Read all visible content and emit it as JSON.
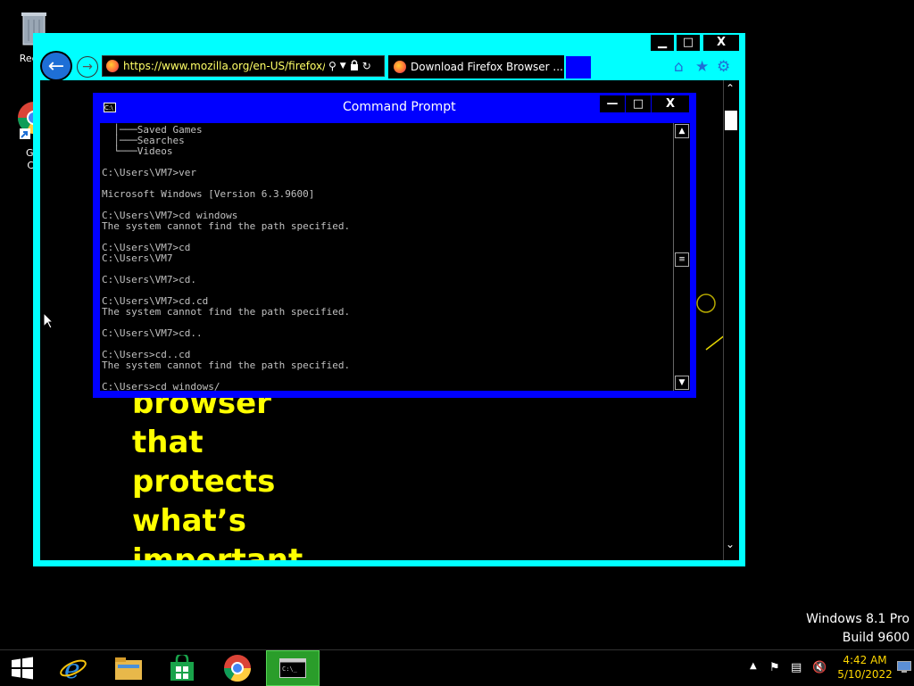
{
  "desktop": {
    "icons": [
      {
        "label": "Recyc"
      },
      {
        "label_line1": "Goo",
        "label_line2": "Chr"
      }
    ]
  },
  "browser": {
    "url": "https://www.mozilla.org/en-US/firefox/ne",
    "tab_title": "Download Firefox Browser ...",
    "controls": {
      "minimize": "▁",
      "maximize": "□",
      "close": "X"
    }
  },
  "page": {
    "headline_lines": [
      "browser",
      "that",
      "protects",
      "what’s",
      "important"
    ]
  },
  "cmd": {
    "title": "Command Prompt",
    "controls": {
      "minimize": "—",
      "maximize": "□",
      "close": "X"
    },
    "lines": [
      "  │───Saved Games",
      "  │───Searches",
      "  └───Videos",
      "",
      "C:\\Users\\VM7>ver",
      "",
      "Microsoft Windows [Version 6.3.9600]",
      "",
      "C:\\Users\\VM7>cd windows",
      "The system cannot find the path specified.",
      "",
      "C:\\Users\\VM7>cd",
      "C:\\Users\\VM7",
      "",
      "C:\\Users\\VM7>cd.",
      "",
      "C:\\Users\\VM7>cd.cd",
      "The system cannot find the path specified.",
      "",
      "C:\\Users\\VM7>cd..",
      "",
      "C:\\Users>cd..cd",
      "The system cannot find the path specified.",
      "",
      "C:\\Users>cd windows/"
    ]
  },
  "watermark": {
    "edition": "Windows 8.1 Pro",
    "build": "Build 9600"
  },
  "clock": {
    "time": "4:42 AM",
    "date": "5/10/2022"
  },
  "colors": {
    "ie_frame": "#00ffff",
    "cmd_frame": "#0000ff",
    "headline": "#ffff00",
    "taskbar_active": "#2a9d2a"
  }
}
